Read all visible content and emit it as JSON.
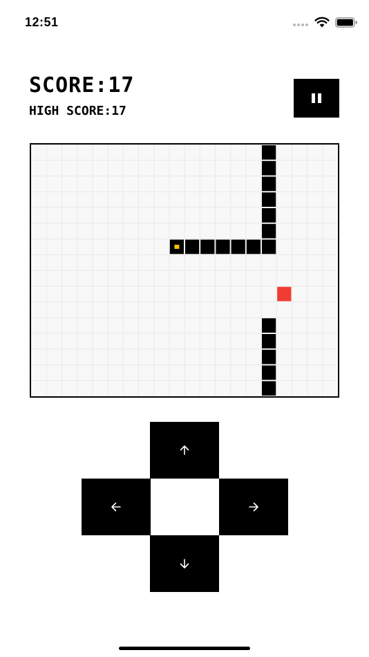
{
  "status_bar": {
    "time": "12:51",
    "icons": [
      "signal-dots-icon",
      "wifi-icon",
      "battery-icon"
    ]
  },
  "score": {
    "label": "SCORE:",
    "value": "17",
    "high_label": "HIGH SCORE:",
    "high_value": "17"
  },
  "pause_button": {
    "icon": "pause-icon"
  },
  "board": {
    "columns": 20,
    "rows": 16,
    "snake": [
      [
        9,
        6
      ],
      [
        10,
        6
      ],
      [
        11,
        6
      ],
      [
        12,
        6
      ],
      [
        13,
        6
      ],
      [
        14,
        6
      ],
      [
        15,
        6
      ],
      [
        15,
        5
      ],
      [
        15,
        4
      ],
      [
        15,
        3
      ],
      [
        15,
        2
      ],
      [
        15,
        1
      ],
      [
        15,
        0
      ],
      [
        15,
        15
      ],
      [
        15,
        14
      ],
      [
        15,
        13
      ],
      [
        15,
        12
      ],
      [
        15,
        11
      ]
    ],
    "food": [
      16,
      9
    ],
    "colors": {
      "snake": "#000000",
      "head_eye": "#f5c400",
      "food": "#f03c32",
      "grid_line": "#e9e9e9",
      "board_bg": "#f8f8f8"
    }
  },
  "controls": {
    "up": "up-arrow-icon",
    "left": "left-arrow-icon",
    "right": "right-arrow-icon",
    "down": "down-arrow-icon"
  }
}
